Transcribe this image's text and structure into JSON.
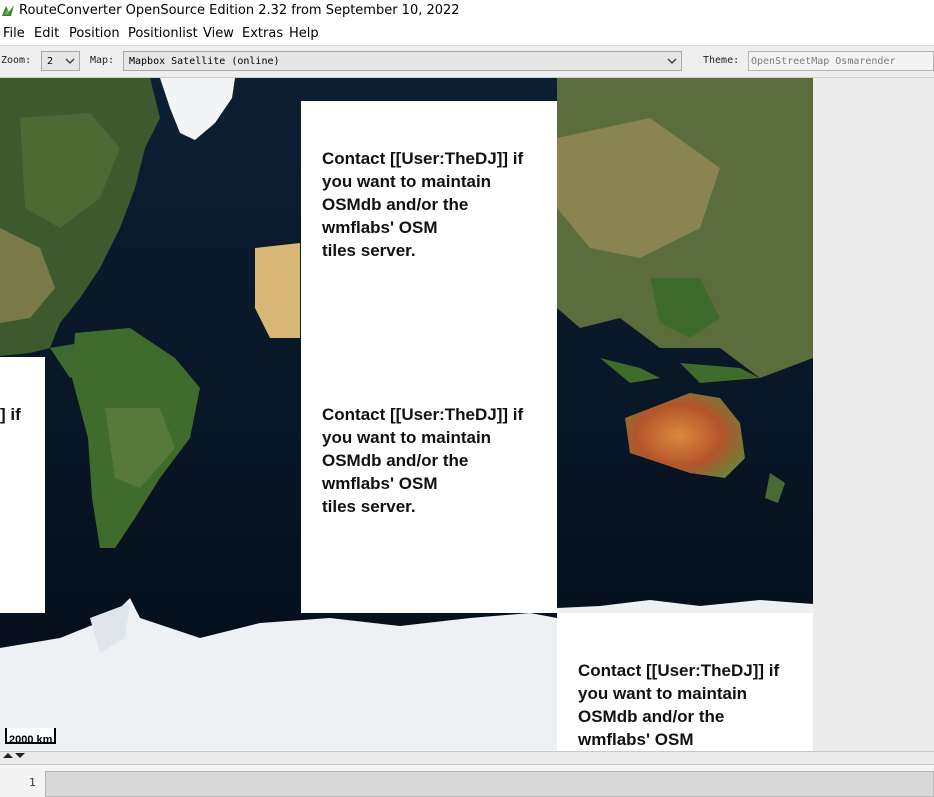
{
  "window": {
    "title": "RouteConverter OpenSource Edition 2.32 from September 10, 2022"
  },
  "menu": {
    "file": "File",
    "edit": "Edit",
    "position": "Position",
    "positionlist": "Positionlist",
    "view": "View",
    "extras": "Extras",
    "help": "Help"
  },
  "toolbar": {
    "zoom_label": "Zoom:",
    "zoom_value": "2",
    "map_label": "Map:",
    "map_value": "Mapbox Satellite (online)",
    "theme_label": "Theme:",
    "theme_value": "OpenStreetMap Osmarender"
  },
  "map": {
    "tile_message": "Contact [[User:TheDJ]] if\nyou want to maintain\nOSMdb and/or the\nwmflabs' OSM\ntiles server.",
    "tile_message_partial": "] if",
    "scale_label": "2000 km"
  },
  "positions_table": {
    "row_number": "1"
  }
}
